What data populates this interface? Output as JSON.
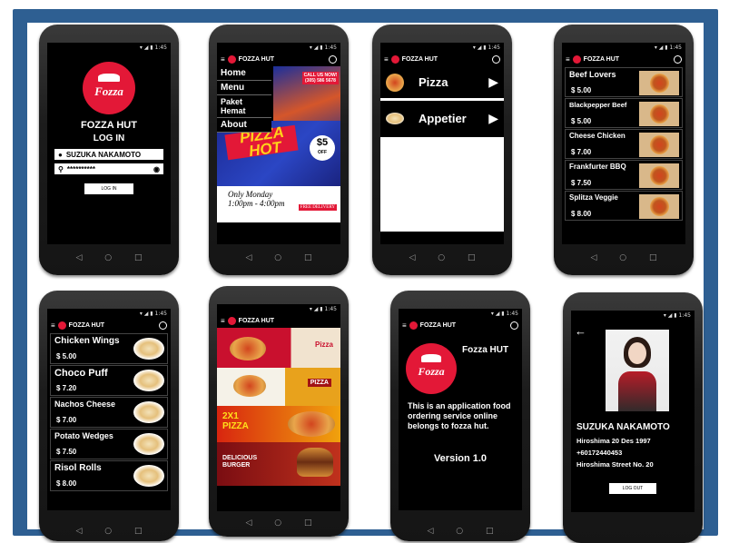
{
  "status_time": "1:45",
  "status_icons": "▾ ◢ ▮",
  "nav": {
    "back": "◁",
    "home": "○",
    "recent": "□"
  },
  "brand": {
    "app_name": "FOZZA HUT",
    "logo_text": "Fozza",
    "menu_icon": "≡"
  },
  "login": {
    "title": "FOZZA HUT",
    "subtitle": "LOG IN",
    "username": "SUZUKA NAKAMOTO",
    "password": "**********",
    "button": "LOG IN"
  },
  "home": {
    "menu": [
      "Home",
      "Menu",
      "Paket Hemat",
      "About"
    ],
    "promo": {
      "call": "CALL US NOW!",
      "phone": "(305) 586 5678",
      "word1": "PIZZA",
      "word2": "HOT",
      "price": "$5",
      "off": "OFF",
      "line1": "Only Monday",
      "line2": "1:00pm - 4:00pm",
      "delivery": "FREE DELIVERY"
    }
  },
  "categories": [
    {
      "label": "Pizza"
    },
    {
      "label": "Appetier"
    }
  ],
  "pizzas": [
    {
      "name": "Beef Lovers",
      "price": "$ 5.00"
    },
    {
      "name": "Blackpepper Beef",
      "price": "$ 5.00"
    },
    {
      "name": "Cheese Chicken",
      "price": "$ 7.00"
    },
    {
      "name": "Frankfurter BBQ",
      "price": "$ 7.50"
    },
    {
      "name": "Splitza Veggie",
      "price": "$ 8.00"
    }
  ],
  "appetizers": [
    {
      "name": "Chicken Wings",
      "price": "$ 5.00"
    },
    {
      "name": "Choco Puff",
      "price": "$ 7.20"
    },
    {
      "name": "Nachos Cheese",
      "price": "$ 7.00"
    },
    {
      "name": "Potato Wedges",
      "price": "$ 7.50"
    },
    {
      "name": "Risol Rolls",
      "price": "$ 8.00"
    }
  ],
  "paket": [
    {
      "text": "Pizza",
      "colors": [
        "#c9102e",
        "#f1e3cf"
      ]
    },
    {
      "text": "PIZZA",
      "colors": [
        "#e8a21c",
        "#f5f2e8"
      ]
    },
    {
      "text": "2X1 PIZZA",
      "colors": [
        "#d8250f",
        "#f0a20d"
      ]
    },
    {
      "text": "DELICIOUS BURGER",
      "colors": [
        "#7a0d12",
        "#c0311c"
      ]
    }
  ],
  "about": {
    "title": "Fozza HUT",
    "desc": "This is an application food ordering service online belongs to fozza hut.",
    "version": "Version 1.0"
  },
  "profile": {
    "name": "SUZUKA NAKAMOTO",
    "birth": "Hiroshima 20 Des 1997",
    "phone": "+60172440453",
    "address": "Hiroshima Street No. 20",
    "logout": "LOG OUT",
    "back_icon": "←"
  }
}
